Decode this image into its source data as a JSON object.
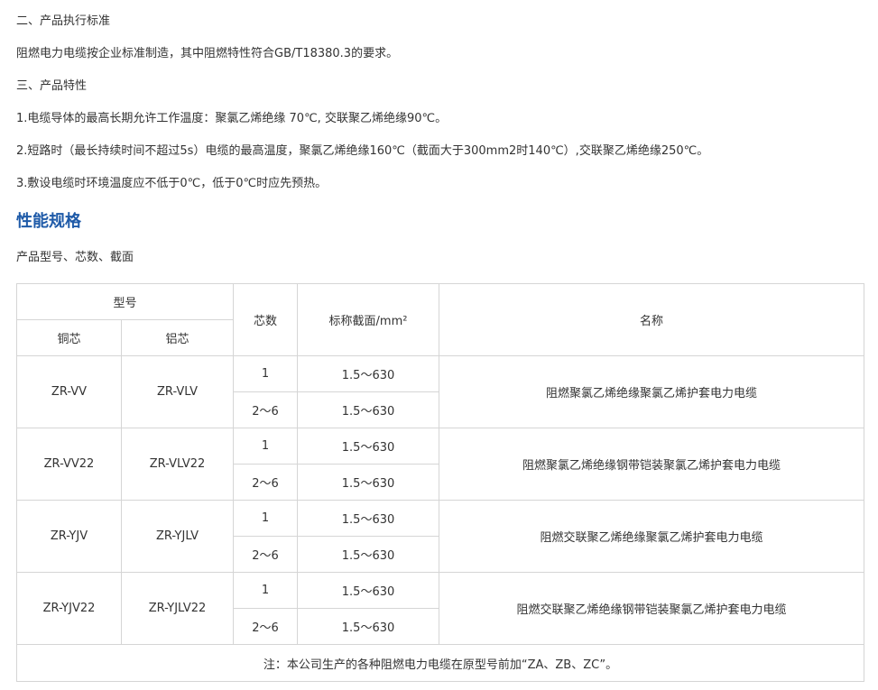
{
  "paragraphs": {
    "p1": "二、产品执行标准",
    "p2": "阻燃电力电缆按企业标准制造，其中阻燃特性符合GB/T18380.3的要求。",
    "p3": "三、产品特性",
    "p4": "1.电缆导体的最高长期允许工作温度：聚氯乙烯绝缘 70℃, 交联聚乙烯绝缘90℃。",
    "p5": "2.短路时（最长持续时间不超过5s）电缆的最高温度，聚氯乙烯绝缘160℃（截面大于300mm2时140℃）,交联聚乙烯绝缘250℃。",
    "p6": "3.敷设电缆时环境温度应不低于0℃，低于0℃时应先预热。"
  },
  "section_title": "性能规格",
  "intro": "产品型号、芯数、截面",
  "table": {
    "header": {
      "model": "型号",
      "copper": "铜芯",
      "aluminum": "铝芯",
      "cores": "芯数",
      "section": "标称截面/mm²",
      "name": "名称"
    },
    "rows": [
      {
        "copper": "ZR-VV",
        "aluminum": "ZR-VLV",
        "cores_a": "1",
        "section_a": "1.5～630",
        "cores_b": "2～6",
        "section_b": "1.5～630",
        "name": "阻燃聚氯乙烯绝缘聚氯乙烯护套电力电缆"
      },
      {
        "copper": "ZR-VV22",
        "aluminum": "ZR-VLV22",
        "cores_a": "1",
        "section_a": "1.5～630",
        "cores_b": "2～6",
        "section_b": "1.5～630",
        "name": "阻燃聚氯乙烯绝缘钢带铠装聚氯乙烯护套电力电缆"
      },
      {
        "copper": "ZR-YJV",
        "aluminum": "ZR-YJLV",
        "cores_a": "1",
        "section_a": "1.5～630",
        "cores_b": "2～6",
        "section_b": "1.5～630",
        "name": "阻燃交联聚乙烯绝缘聚氯乙烯护套电力电缆"
      },
      {
        "copper": "ZR-YJV22",
        "aluminum": "ZR-YJLV22",
        "cores_a": "1",
        "section_a": "1.5～630",
        "cores_b": "2～6",
        "section_b": "1.5～630",
        "name": "阻燃交联聚乙烯绝缘钢带铠装聚氯乙烯护套电力电缆"
      }
    ],
    "note": "注：本公司生产的各种阻燃电力电缆在原型号前加“ZA、ZB、ZC”。"
  }
}
